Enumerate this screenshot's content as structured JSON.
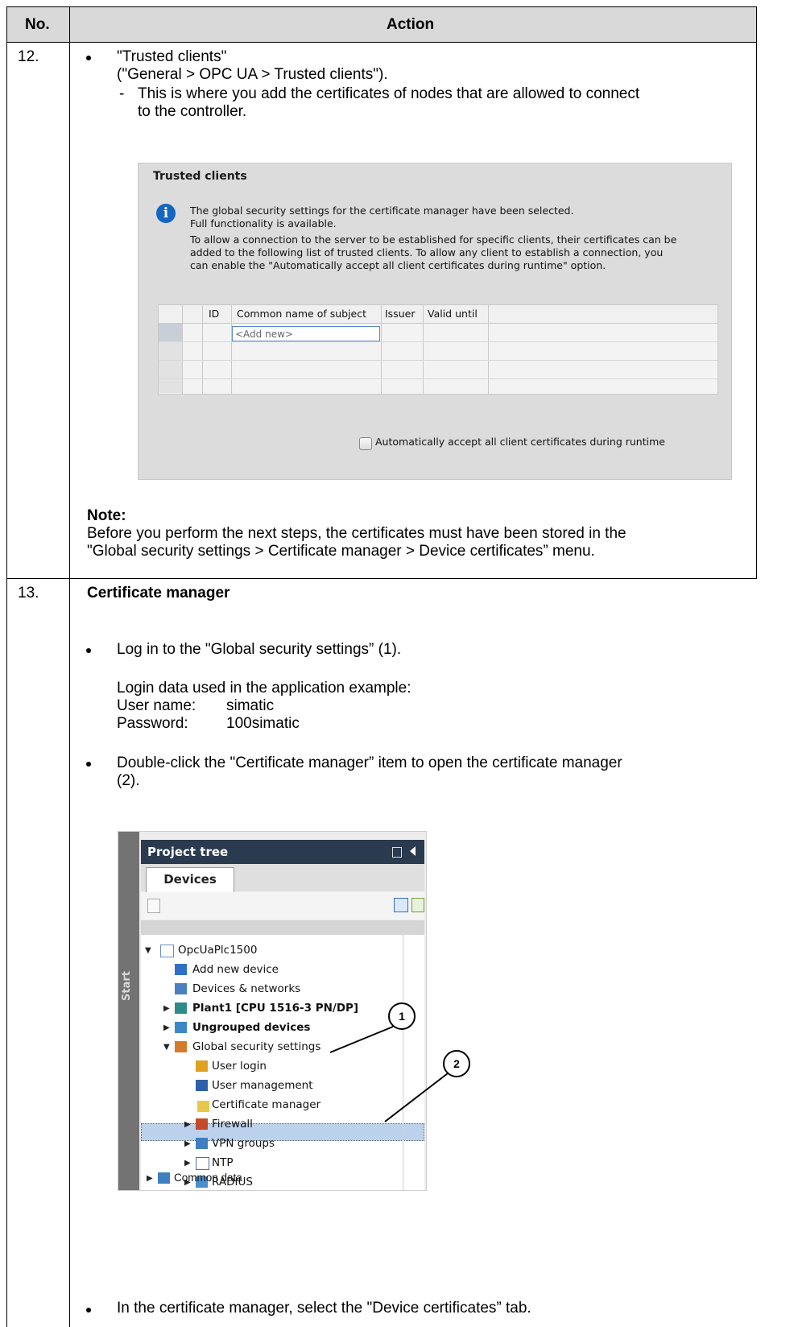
{
  "table": {
    "header_no": "No.",
    "header_action": "Action"
  },
  "step12": {
    "number": "12.",
    "bullet_title": "\"Trusted clients\"",
    "bullet_path": "(\"General > OPC UA > Trusted clients\").",
    "sub_dash": "-",
    "sub_line1": "This is where you add the certificates of nodes that are allowed to connect",
    "sub_line2": "to the controller.",
    "note_label": "Note:",
    "note_line1": "Before you perform the next steps, the certificates must have been stored in the",
    "note_line2": "\"Global security settings > Certificate manager > Device certificates” menu."
  },
  "trusted_clients_panel": {
    "title": "Trusted clients",
    "info_icon_glyph": "i",
    "info_lines": [
      "The global security settings for the certificate manager have been selected.",
      "Full functionality is available.",
      "To allow a connection to the server to be established for specific clients, their certificates can be",
      "added to the following list of trusted clients. To allow any client to establish a connection, you",
      "can enable the \"Automatically accept all client certificates during runtime\" option."
    ],
    "columns": [
      "ID",
      "Common name of subject",
      "Issuer",
      "Valid until"
    ],
    "add_new_placeholder": "<Add new>",
    "checkbox_label": "Automatically accept all client certificates during runtime",
    "checkbox_checked": false
  },
  "step13": {
    "number": "13.",
    "title": "Certificate manager",
    "bullet1": "Log in to the \"Global security settings” (1).",
    "login_intro": "Login data used in the application example:",
    "user_label": "User name:",
    "user_value": "simatic",
    "pass_label": "Password:",
    "pass_value": "100simatic",
    "bullet2_line1": "Double-click the \"Certificate manager” item to open the certificate manager",
    "bullet2_line2": "(2).",
    "bullet3": "In the certificate manager, select the \"Device certificates” tab."
  },
  "project_tree": {
    "sidebar_label": "Start",
    "header": "Project tree",
    "tab": "Devices",
    "items": [
      {
        "label": "OpcUaPlc1500",
        "icon": "project-icon"
      },
      {
        "label": "Add new device",
        "icon": "add-device-icon"
      },
      {
        "label": "Devices & networks",
        "icon": "network-icon"
      },
      {
        "label": "Plant1 [CPU 1516-3 PN/DP]",
        "icon": "cpu-icon"
      },
      {
        "label": "Ungrouped devices",
        "icon": "ungrouped-devices-icon"
      },
      {
        "label": "Global security settings",
        "icon": "security-settings-icon"
      },
      {
        "label": "User login",
        "icon": "user-login-icon"
      },
      {
        "label": "User management",
        "icon": "user-management-icon"
      },
      {
        "label": "Certificate manager",
        "icon": "certificate-icon"
      },
      {
        "label": "Firewall",
        "icon": "firewall-icon"
      },
      {
        "label": "VPN groups",
        "icon": "vpn-icon"
      },
      {
        "label": "NTP",
        "icon": "ntp-icon"
      },
      {
        "label": "RADIUS",
        "icon": "radius-icon"
      },
      {
        "label": "Common data",
        "icon": "common-data-icon"
      }
    ],
    "callout_1": "1",
    "callout_2": "2"
  }
}
